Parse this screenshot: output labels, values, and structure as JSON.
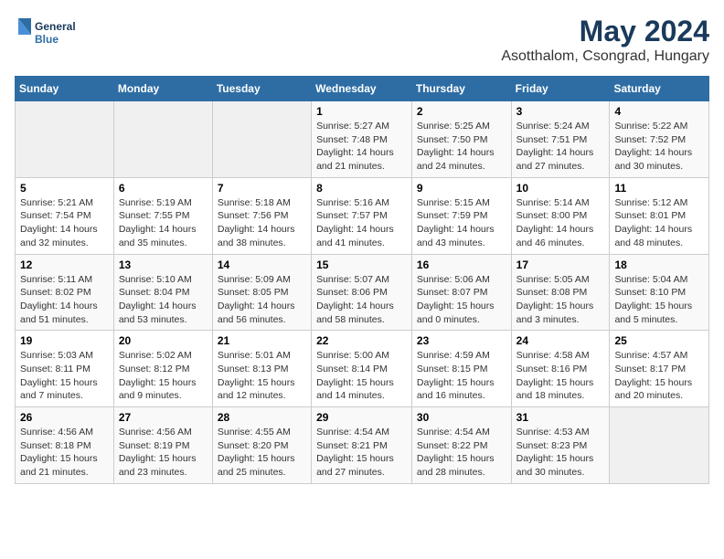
{
  "header": {
    "logo_line1": "General",
    "logo_line2": "Blue",
    "title": "May 2024",
    "subtitle": "Asotthalom, Csongrad, Hungary"
  },
  "weekdays": [
    "Sunday",
    "Monday",
    "Tuesday",
    "Wednesday",
    "Thursday",
    "Friday",
    "Saturday"
  ],
  "weeks": [
    [
      {
        "day": "",
        "info": ""
      },
      {
        "day": "",
        "info": ""
      },
      {
        "day": "",
        "info": ""
      },
      {
        "day": "1",
        "info": "Sunrise: 5:27 AM\nSunset: 7:48 PM\nDaylight: 14 hours\nand 21 minutes."
      },
      {
        "day": "2",
        "info": "Sunrise: 5:25 AM\nSunset: 7:50 PM\nDaylight: 14 hours\nand 24 minutes."
      },
      {
        "day": "3",
        "info": "Sunrise: 5:24 AM\nSunset: 7:51 PM\nDaylight: 14 hours\nand 27 minutes."
      },
      {
        "day": "4",
        "info": "Sunrise: 5:22 AM\nSunset: 7:52 PM\nDaylight: 14 hours\nand 30 minutes."
      }
    ],
    [
      {
        "day": "5",
        "info": "Sunrise: 5:21 AM\nSunset: 7:54 PM\nDaylight: 14 hours\nand 32 minutes."
      },
      {
        "day": "6",
        "info": "Sunrise: 5:19 AM\nSunset: 7:55 PM\nDaylight: 14 hours\nand 35 minutes."
      },
      {
        "day": "7",
        "info": "Sunrise: 5:18 AM\nSunset: 7:56 PM\nDaylight: 14 hours\nand 38 minutes."
      },
      {
        "day": "8",
        "info": "Sunrise: 5:16 AM\nSunset: 7:57 PM\nDaylight: 14 hours\nand 41 minutes."
      },
      {
        "day": "9",
        "info": "Sunrise: 5:15 AM\nSunset: 7:59 PM\nDaylight: 14 hours\nand 43 minutes."
      },
      {
        "day": "10",
        "info": "Sunrise: 5:14 AM\nSunset: 8:00 PM\nDaylight: 14 hours\nand 46 minutes."
      },
      {
        "day": "11",
        "info": "Sunrise: 5:12 AM\nSunset: 8:01 PM\nDaylight: 14 hours\nand 48 minutes."
      }
    ],
    [
      {
        "day": "12",
        "info": "Sunrise: 5:11 AM\nSunset: 8:02 PM\nDaylight: 14 hours\nand 51 minutes."
      },
      {
        "day": "13",
        "info": "Sunrise: 5:10 AM\nSunset: 8:04 PM\nDaylight: 14 hours\nand 53 minutes."
      },
      {
        "day": "14",
        "info": "Sunrise: 5:09 AM\nSunset: 8:05 PM\nDaylight: 14 hours\nand 56 minutes."
      },
      {
        "day": "15",
        "info": "Sunrise: 5:07 AM\nSunset: 8:06 PM\nDaylight: 14 hours\nand 58 minutes."
      },
      {
        "day": "16",
        "info": "Sunrise: 5:06 AM\nSunset: 8:07 PM\nDaylight: 15 hours\nand 0 minutes."
      },
      {
        "day": "17",
        "info": "Sunrise: 5:05 AM\nSunset: 8:08 PM\nDaylight: 15 hours\nand 3 minutes."
      },
      {
        "day": "18",
        "info": "Sunrise: 5:04 AM\nSunset: 8:10 PM\nDaylight: 15 hours\nand 5 minutes."
      }
    ],
    [
      {
        "day": "19",
        "info": "Sunrise: 5:03 AM\nSunset: 8:11 PM\nDaylight: 15 hours\nand 7 minutes."
      },
      {
        "day": "20",
        "info": "Sunrise: 5:02 AM\nSunset: 8:12 PM\nDaylight: 15 hours\nand 9 minutes."
      },
      {
        "day": "21",
        "info": "Sunrise: 5:01 AM\nSunset: 8:13 PM\nDaylight: 15 hours\nand 12 minutes."
      },
      {
        "day": "22",
        "info": "Sunrise: 5:00 AM\nSunset: 8:14 PM\nDaylight: 15 hours\nand 14 minutes."
      },
      {
        "day": "23",
        "info": "Sunrise: 4:59 AM\nSunset: 8:15 PM\nDaylight: 15 hours\nand 16 minutes."
      },
      {
        "day": "24",
        "info": "Sunrise: 4:58 AM\nSunset: 8:16 PM\nDaylight: 15 hours\nand 18 minutes."
      },
      {
        "day": "25",
        "info": "Sunrise: 4:57 AM\nSunset: 8:17 PM\nDaylight: 15 hours\nand 20 minutes."
      }
    ],
    [
      {
        "day": "26",
        "info": "Sunrise: 4:56 AM\nSunset: 8:18 PM\nDaylight: 15 hours\nand 21 minutes."
      },
      {
        "day": "27",
        "info": "Sunrise: 4:56 AM\nSunset: 8:19 PM\nDaylight: 15 hours\nand 23 minutes."
      },
      {
        "day": "28",
        "info": "Sunrise: 4:55 AM\nSunset: 8:20 PM\nDaylight: 15 hours\nand 25 minutes."
      },
      {
        "day": "29",
        "info": "Sunrise: 4:54 AM\nSunset: 8:21 PM\nDaylight: 15 hours\nand 27 minutes."
      },
      {
        "day": "30",
        "info": "Sunrise: 4:54 AM\nSunset: 8:22 PM\nDaylight: 15 hours\nand 28 minutes."
      },
      {
        "day": "31",
        "info": "Sunrise: 4:53 AM\nSunset: 8:23 PM\nDaylight: 15 hours\nand 30 minutes."
      },
      {
        "day": "",
        "info": ""
      }
    ]
  ]
}
